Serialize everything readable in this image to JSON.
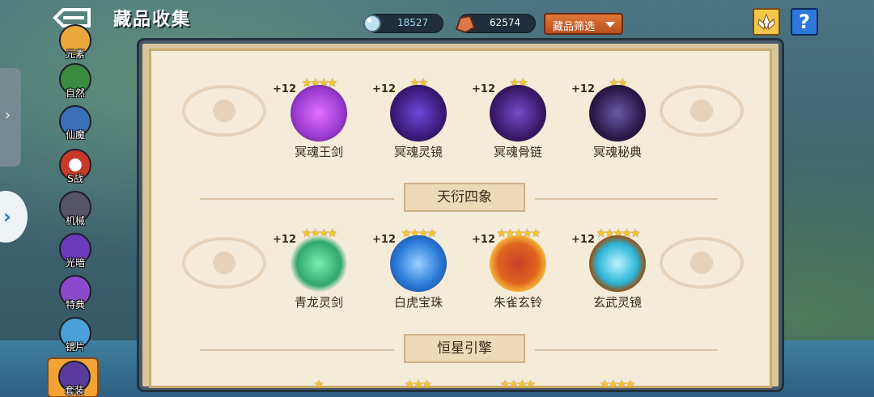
{
  "header": {
    "title": "藏品收集",
    "back_icon": "back-arrow-icon"
  },
  "currencies": [
    {
      "icon": "crystal-icon",
      "value": "18527",
      "color": "#9fd4ef"
    },
    {
      "icon": "ore-icon",
      "value": "62574",
      "color": "#ffffff"
    }
  ],
  "filter": {
    "label": "藏品筛选"
  },
  "sidebar": {
    "items": [
      {
        "label": "元素",
        "color": "#e9a93a"
      },
      {
        "label": "自然",
        "color": "#3b8a42"
      },
      {
        "label": "仙魔",
        "color": "#3a6fb8"
      },
      {
        "label": "S战",
        "color": "#c83a2a"
      },
      {
        "label": "机械",
        "color": "#555566"
      },
      {
        "label": "光暗",
        "color": "#6a3ab8"
      },
      {
        "label": "特典",
        "color": "#8a4acb"
      },
      {
        "label": "镜片",
        "color": "#4aa0d8"
      },
      {
        "label": "套装",
        "color": "#5a3a9a",
        "active": true
      }
    ]
  },
  "sections": [
    {
      "title": "天衍四象"
    },
    {
      "title": "恒星引擎"
    }
  ],
  "rows": [
    {
      "items": [
        {
          "name": "冥魂王剑",
          "level": "+12",
          "stars": 4,
          "color": "#9a3ad0"
        },
        {
          "name": "冥魂灵镜",
          "level": "+12",
          "stars": 2,
          "color": "#5a2a9a"
        },
        {
          "name": "冥魂骨链",
          "level": "+12",
          "stars": 2,
          "color": "#4a2a7a"
        },
        {
          "name": "冥魂秘典",
          "level": "+12",
          "stars": 2,
          "color": "#3a2a6a"
        }
      ]
    },
    {
      "items": [
        {
          "name": "青龙灵剑",
          "level": "+12",
          "stars": 4,
          "color": "#2fa86a"
        },
        {
          "name": "白虎宝珠",
          "level": "+12",
          "stars": 4,
          "color": "#2a7ad8"
        },
        {
          "name": "朱雀玄铃",
          "level": "+12",
          "stars": 5,
          "color": "#e0641e"
        },
        {
          "name": "玄武灵镜",
          "level": "+12",
          "stars": 5,
          "color": "#2ab4d8"
        }
      ]
    }
  ],
  "bottom_row_stars": [
    1,
    3,
    4,
    4
  ]
}
